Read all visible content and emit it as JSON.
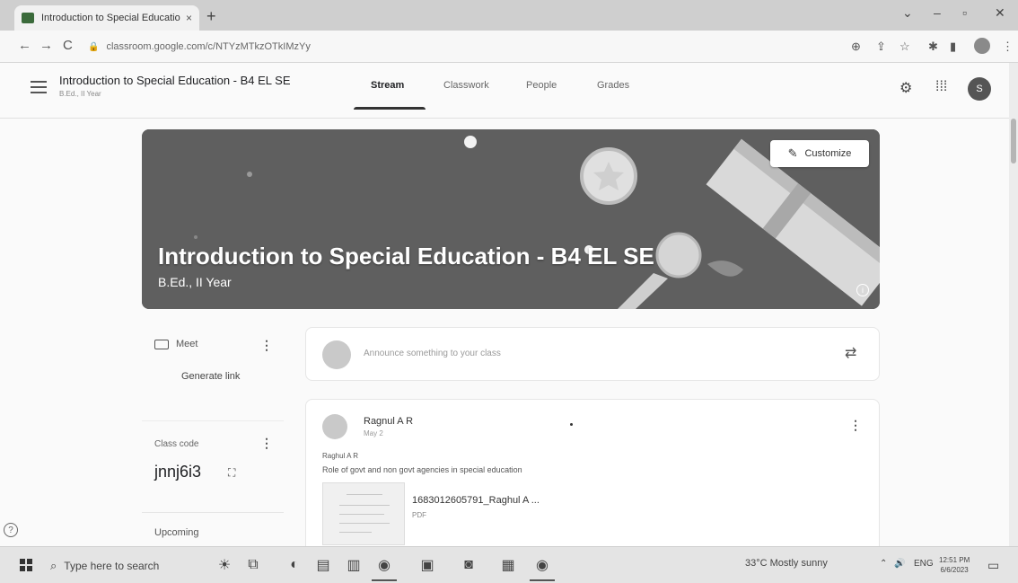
{
  "browser": {
    "tab_title": "Introduction to Special Educatio",
    "tab_close": "×",
    "new_tab": "+",
    "url": "classroom.google.com/c/NTYzMTkzOTkIMzYy",
    "nav": {
      "back": "←",
      "forward": "→",
      "reload": "C"
    },
    "window": {
      "minimize": "–",
      "maximize": "▫",
      "close": "✕",
      "tab_search": "⌄"
    }
  },
  "header": {
    "class_title": "Introduction to Special Education - B4 EL SE",
    "class_subtitle": "B.Ed., II Year",
    "tabs": [
      {
        "label": "Stream",
        "active": true
      },
      {
        "label": "Classwork",
        "active": false
      },
      {
        "label": "People",
        "active": false
      },
      {
        "label": "Grades",
        "active": false
      }
    ],
    "avatar_letter": "S"
  },
  "banner": {
    "title": "Introduction to Special Education - B4 EL SE",
    "subtitle": "B.Ed., II Year",
    "customize_label": "Customize"
  },
  "meet": {
    "label": "Meet",
    "generate_link": "Generate link"
  },
  "class_code": {
    "label": "Class code",
    "value": "jnnj6i3"
  },
  "upcoming": {
    "label": "Upcoming"
  },
  "announce": {
    "placeholder": "Announce something to your class"
  },
  "post": {
    "author": "Ragnul A R",
    "date": "May 2",
    "line1": "Raghul A R",
    "line2": "Role of govt and non govt agencies in special education",
    "attachment_name": "1683012605791_Raghul A ...",
    "attachment_type": "PDF"
  },
  "taskbar": {
    "search_placeholder": "Type here to search",
    "weather": "33°C  Mostly sunny",
    "language": "ENG",
    "time": "12:51 PM",
    "date": "6/6/2023"
  },
  "colors": {
    "banner_bg": "#5f5f5f",
    "accent": "#333333"
  }
}
